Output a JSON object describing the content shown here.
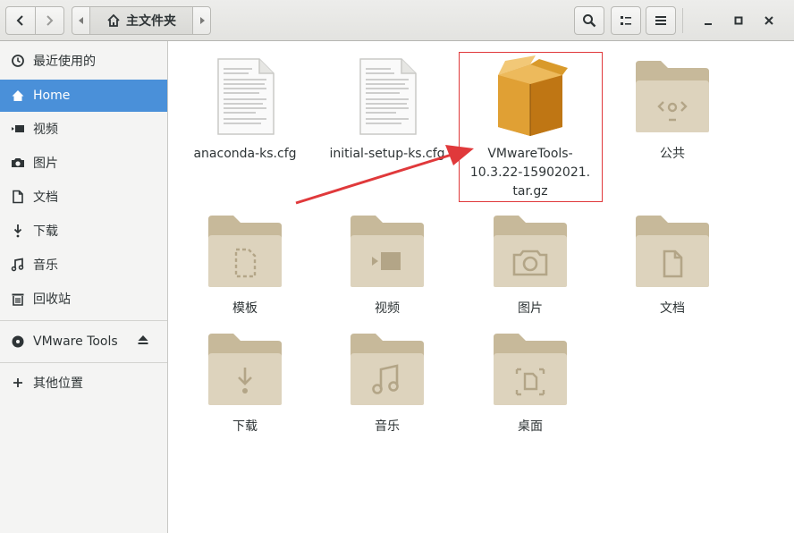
{
  "header": {
    "location": "主文件夹",
    "icons": {
      "back": "chevron-left-icon",
      "forward": "chevron-right-icon",
      "home": "home-icon",
      "search": "search-icon",
      "view": "view-options-icon",
      "menu": "hamburger-menu-icon",
      "minimize": "minimize-icon",
      "maximize": "maximize-icon",
      "close": "close-icon"
    }
  },
  "sidebar": {
    "items": [
      {
        "label": "最近使用的",
        "icon": "clock-icon"
      },
      {
        "label": "Home",
        "icon": "home-icon",
        "active": true
      },
      {
        "label": "视频",
        "icon": "video-icon"
      },
      {
        "label": "图片",
        "icon": "camera-icon"
      },
      {
        "label": "文档",
        "icon": "document-icon"
      },
      {
        "label": "下载",
        "icon": "download-icon"
      },
      {
        "label": "音乐",
        "icon": "music-icon"
      },
      {
        "label": "回收站",
        "icon": "trash-icon"
      }
    ],
    "devices": [
      {
        "label": "VMware Tools",
        "icon": "disc-icon",
        "eject_icon": "eject-icon"
      }
    ],
    "other": {
      "label": "其他位置",
      "icon": "plus-icon"
    }
  },
  "files": [
    {
      "label": "anaconda-ks.cfg",
      "type": "text-file"
    },
    {
      "label": "initial-setup-ks.cfg",
      "type": "text-file"
    },
    {
      "label": "VMwareTools-10.3.22-15902021.tar.gz",
      "label_lines": [
        "VMwareTools-",
        "10.3.22-15902021.",
        "tar.gz"
      ],
      "type": "archive"
    },
    {
      "label": "公共",
      "type": "folder",
      "emblem": "share-icon"
    },
    {
      "label": "模板",
      "type": "folder",
      "emblem": "template-icon"
    },
    {
      "label": "视频",
      "type": "folder",
      "emblem": "video-icon"
    },
    {
      "label": "图片",
      "type": "folder",
      "emblem": "camera-icon"
    },
    {
      "label": "文档",
      "type": "folder",
      "emblem": "document-icon"
    },
    {
      "label": "下载",
      "type": "folder",
      "emblem": "download-icon"
    },
    {
      "label": "音乐",
      "type": "folder",
      "emblem": "music-icon"
    },
    {
      "label": "桌面",
      "type": "folder",
      "emblem": "desktop-icon"
    }
  ],
  "annotation": {
    "color": "#e0393b",
    "target": "VMwareTools-10.3.22-15902021.tar.gz"
  },
  "colors": {
    "accent": "#4a90d9",
    "folder": "#d6ccb4",
    "folder_tab": "#c7b99a",
    "archive": "#d99a2b"
  }
}
